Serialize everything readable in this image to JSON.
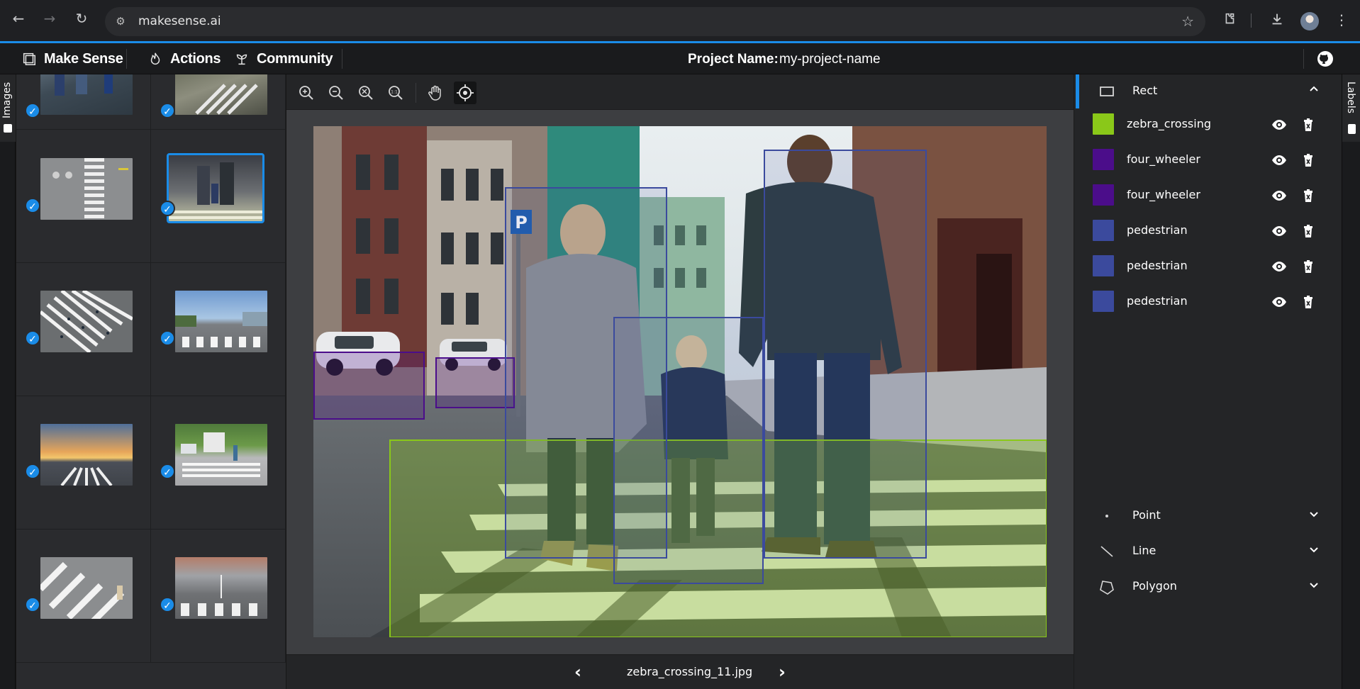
{
  "browser": {
    "url": "makesense.ai"
  },
  "app": {
    "brand": "Make Sense",
    "menus": [
      "Actions",
      "Community"
    ],
    "project_label": "Project Name:",
    "project_name": "my-project-name"
  },
  "left_tab": {
    "label": "Images"
  },
  "right_tab": {
    "label": "Labels"
  },
  "thumbnails": [
    {
      "checked": true,
      "active": false
    },
    {
      "checked": true,
      "active": false
    },
    {
      "checked": true,
      "active": false
    },
    {
      "checked": true,
      "active": true
    },
    {
      "checked": true,
      "active": false
    },
    {
      "checked": true,
      "active": false
    },
    {
      "checked": true,
      "active": false
    },
    {
      "checked": true,
      "active": false
    },
    {
      "checked": true,
      "active": false
    },
    {
      "checked": true,
      "active": false
    }
  ],
  "toolbar": {
    "tools": [
      "zoom-in-icon",
      "zoom-out-icon",
      "zoom-fit-icon",
      "zoom-actual-icon",
      "hand-icon",
      "crosshair-icon"
    ],
    "active_tool": "crosshair-icon"
  },
  "editor": {
    "filename": "zebra_crossing_11.jpg"
  },
  "right_panel": {
    "sections": {
      "rect": "Rect",
      "point": "Point",
      "line": "Line",
      "polygon": "Polygon"
    },
    "labels": [
      {
        "name": "zebra_crossing",
        "color": "#8ac819"
      },
      {
        "name": "four_wheeler",
        "color": "#4b0d8a"
      },
      {
        "name": "four_wheeler",
        "color": "#4b0d8a"
      },
      {
        "name": "pedestrian",
        "color": "#3b4a9d"
      },
      {
        "name": "pedestrian",
        "color": "#3b4a9d"
      },
      {
        "name": "pedestrian",
        "color": "#3b4a9d"
      }
    ]
  },
  "colors": {
    "accent": "#1a8ce8",
    "zebra_crossing": "#8ac819",
    "four_wheeler": "#4b0d8a",
    "pedestrian": "#3b4a9d"
  }
}
